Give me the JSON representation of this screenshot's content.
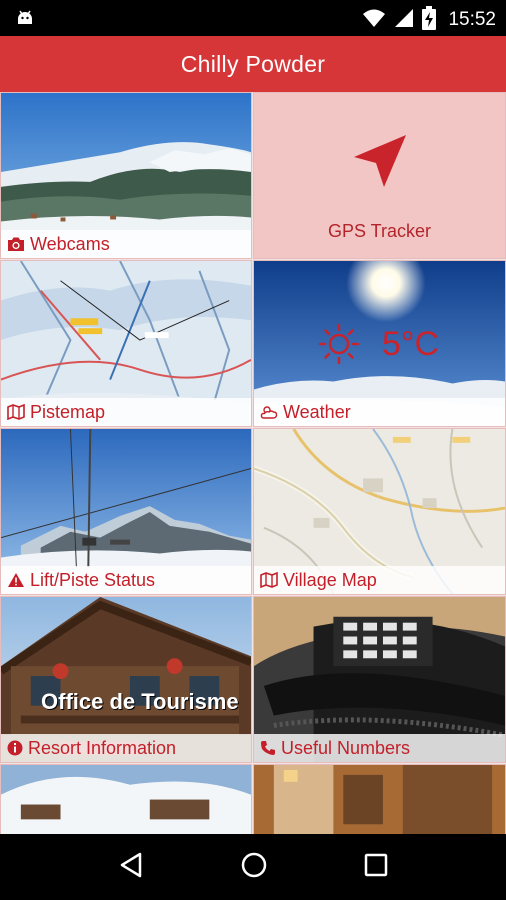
{
  "status_bar": {
    "time": "15:52",
    "icons": [
      "android-icon",
      "wifi-icon",
      "signal-icon",
      "battery-charging-icon"
    ]
  },
  "app_bar": {
    "title": "Chilly Powder"
  },
  "tiles": [
    {
      "label": "Webcams",
      "icon": "camera-icon"
    },
    {
      "label": "GPS Tracker",
      "icon": "navigation-arrow-icon"
    },
    {
      "label": "Pistemap",
      "icon": "map-icon"
    },
    {
      "label": "Weather",
      "icon": "cloud-sun-icon",
      "temperature": "5°C"
    },
    {
      "label": "Lift/Piste Status",
      "icon": "warning-icon"
    },
    {
      "label": "Village Map",
      "icon": "map-icon"
    },
    {
      "label": "Resort Information",
      "icon": "info-icon",
      "sign_text": "Office de Tourisme"
    },
    {
      "label": "Useful Numbers",
      "icon": "phone-icon"
    },
    {
      "label": "",
      "icon": ""
    },
    {
      "label": "",
      "icon": ""
    }
  ],
  "colors": {
    "accent": "#d63638",
    "label_text": "#c3202a",
    "gps_bg": "#f3c6c6"
  },
  "nav_bar": {
    "buttons": [
      "back-icon",
      "home-icon",
      "recents-icon"
    ]
  }
}
